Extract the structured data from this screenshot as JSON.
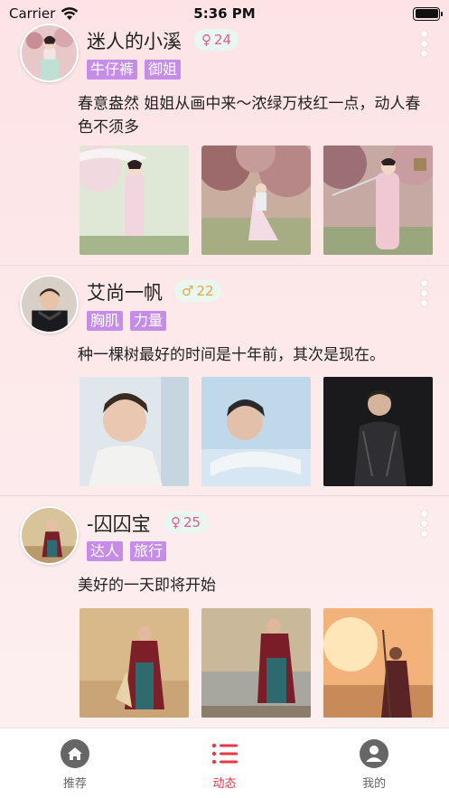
{
  "status_bar": {
    "carrier": "Carrier",
    "time": "5:36 PM"
  },
  "posts": [
    {
      "name": "迷人的小溪",
      "gender_symbol": "♀",
      "age": "24",
      "tags": [
        "牛仔裤",
        "御姐"
      ],
      "content": "春意盎然 姐姐从画中来～浓绿万枝红一点，动人春色不须多"
    },
    {
      "name": "艾尚一帆",
      "gender_symbol": "♂",
      "age": "22",
      "tags": [
        "胸肌",
        "力量"
      ],
      "content": "种一棵树最好的时间是十年前，其次是现在。"
    },
    {
      "name": "-囚囚宝",
      "gender_symbol": "♀",
      "age": "25",
      "tags": [
        "达人",
        "旅行"
      ],
      "content": "美好的一天即将开始"
    }
  ],
  "tabbar": {
    "items": [
      {
        "label": "推荐",
        "icon": "home-icon",
        "active": false
      },
      {
        "label": "动态",
        "icon": "list-icon",
        "active": true
      },
      {
        "label": "我的",
        "icon": "user-icon",
        "active": false
      }
    ],
    "active_color": "#e63946"
  }
}
